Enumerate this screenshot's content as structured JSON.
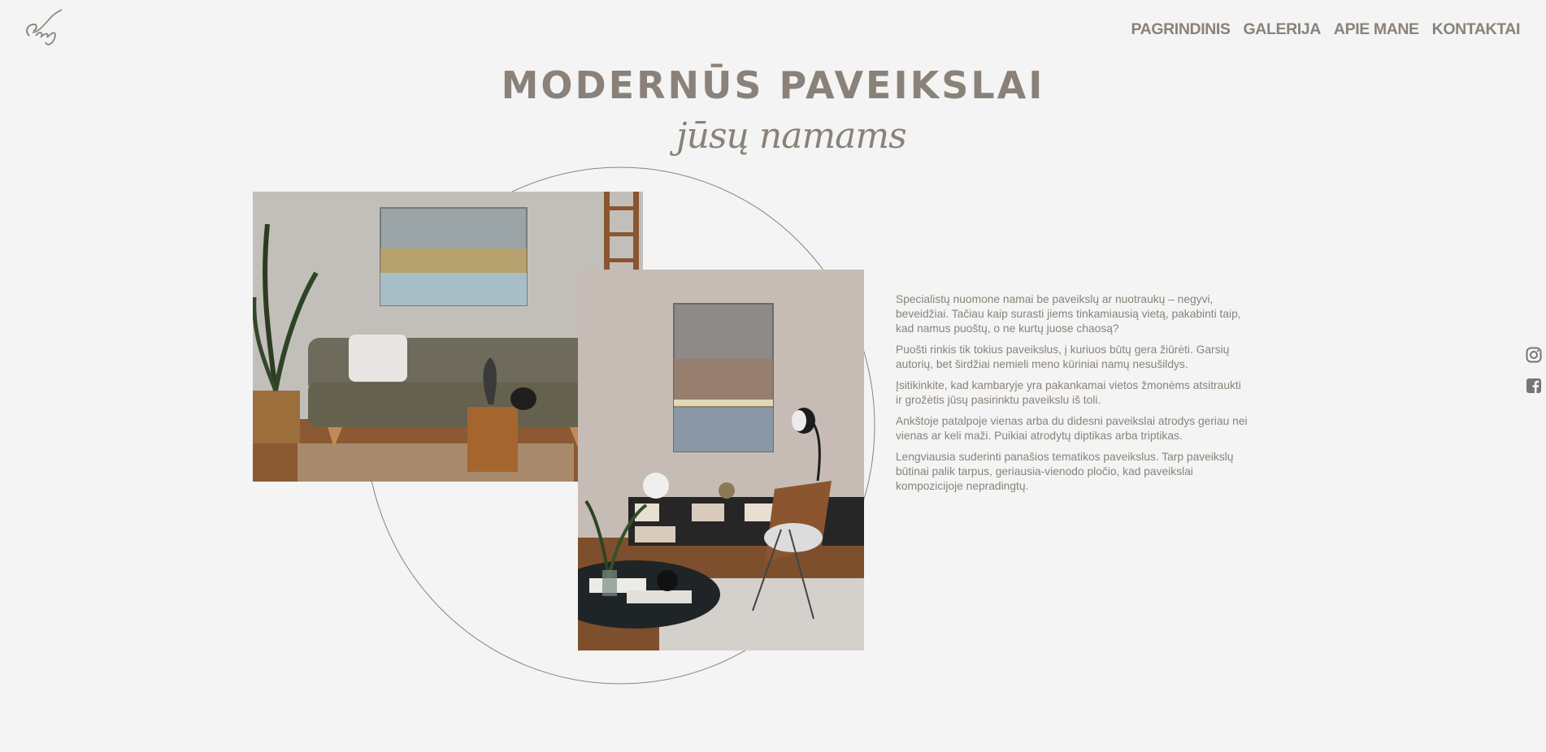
{
  "nav": {
    "items": [
      {
        "label": "PAGRINDINIS"
      },
      {
        "label": "GALERIJA"
      },
      {
        "label": "APIE MANE"
      },
      {
        "label": "KONTAKTAI"
      }
    ]
  },
  "hero": {
    "title": "MODERNŪS PAVEIKSLAI",
    "subtitle": "jūsų namams"
  },
  "intro": {
    "paragraphs": [
      "Specialistų nuomone namai be paveikslų ar nuotraukų – negyvi, beveidžiai. Tačiau kaip surasti jiems tinkamiausią vietą, pakabinti taip, kad namus puoštų, o ne kurtų juose chaosą?",
      "Puošti rinkis tik tokius paveikslus, į kuriuos būtų gera žiūrėti. Garsių autorių, bet širdžiai nemieli meno kūriniai namų nesušildys.",
      "Įsitikinkite, kad kambaryje yra pakankamai vietos žmonėms atsitraukti ir grožėtis jūsų pasirinktu paveikslu iš toli.",
      "Ankštoje patalpoje vienas arba du didesni paveikslai atrodys geriau nei vienas ar keli maži. Puikiai atrodytų diptikas arba triptikas.",
      "Lengviausia suderinti panašios tematikos paveikslus. Tarp paveikslų būtinai palik tarpus, geriausia-vienodo pločio, kad paveikslai kompozicijoje nepradingtų."
    ]
  },
  "social": {
    "icons": [
      "instagram-icon",
      "facebook-icon"
    ]
  },
  "colors": {
    "background": "#f4f4f4",
    "text": "#8a8279"
  }
}
